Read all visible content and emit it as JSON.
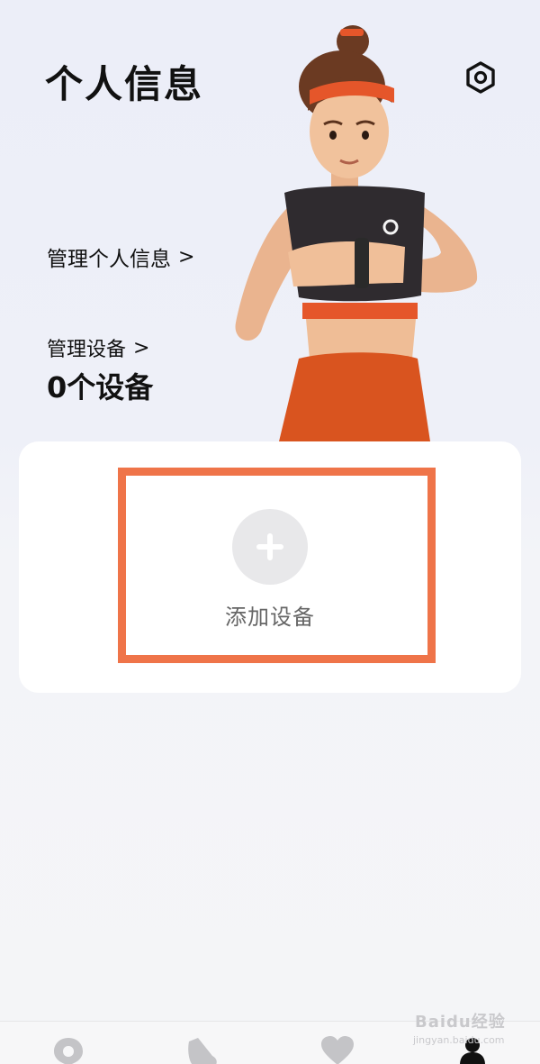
{
  "header": {
    "title": "个人信息"
  },
  "profile": {
    "manage_label": "管理个人信息",
    "chevron": ">"
  },
  "devices": {
    "manage_label": "管理设备",
    "chevron": ">",
    "count_text": "0个设备"
  },
  "add_device": {
    "label": "添加设备"
  },
  "icons": {
    "settings": "gear-icon",
    "add": "plus-icon",
    "tabs": [
      "location-pin-icon",
      "shoe-icon",
      "heart-icon",
      "person-icon"
    ]
  },
  "colors": {
    "accent": "#ef7449",
    "headband": "#e5562a",
    "pants": "#d9541f"
  },
  "watermark": {
    "top": "Baidu经验",
    "bottom": "jingyan.baidu.com"
  }
}
